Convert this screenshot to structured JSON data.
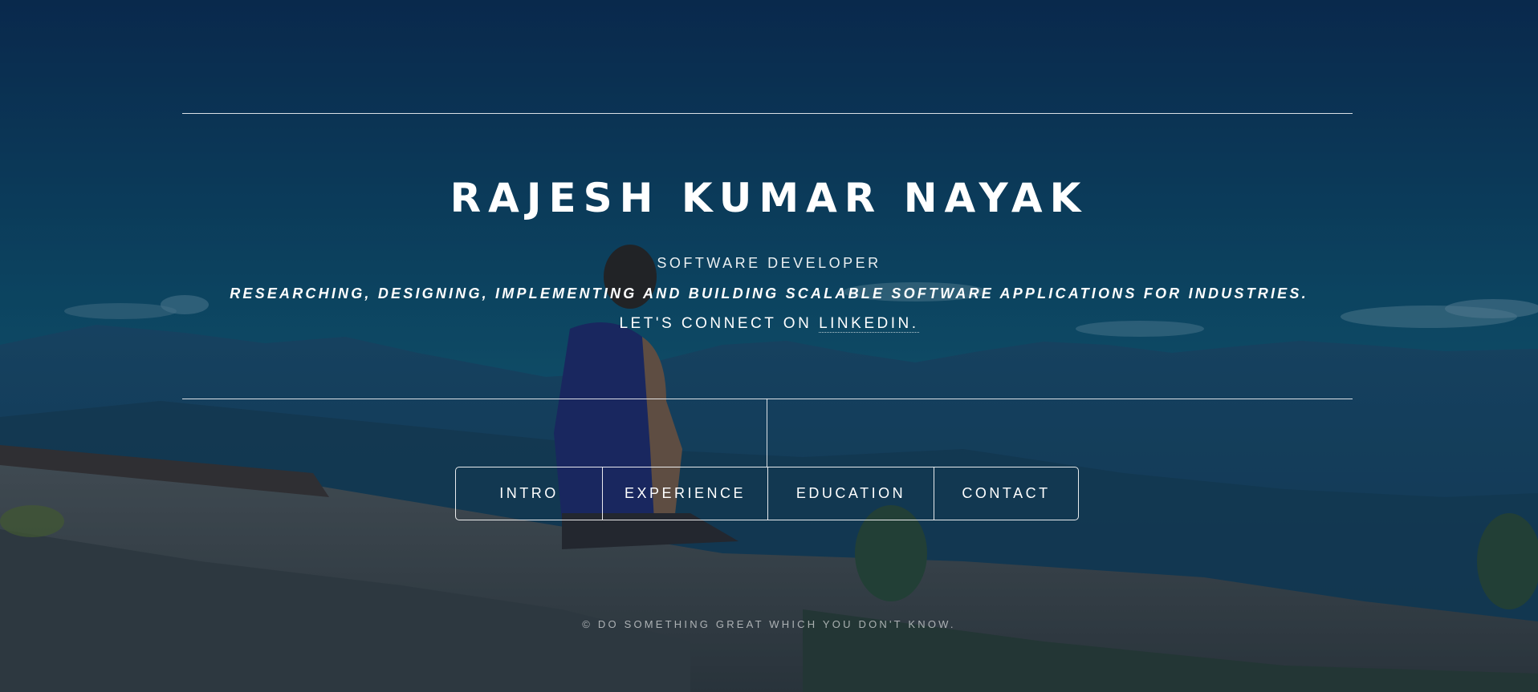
{
  "header": {
    "name": "RAJESH KUMAR NAYAK",
    "role": "SOFTWARE DEVELOPER",
    "tagline": "RESEARCHING, DESIGNING, IMPLEMENTING AND BUILDING SCALABLE SOFTWARE APPLICATIONS FOR INDUSTRIES.",
    "connect_prefix": "LET'S CONNECT ON ",
    "connect_link": "LINKEDIN."
  },
  "nav": {
    "items": [
      {
        "label": "INTRO"
      },
      {
        "label": "EXPERIENCE"
      },
      {
        "label": "EDUCATION"
      },
      {
        "label": "CONTACT"
      }
    ]
  },
  "footer": {
    "text": "© DO SOMETHING GREAT WHICH YOU DON'T KNOW."
  },
  "colors": {
    "overlay": "#0b2f55",
    "text": "#ffffff"
  }
}
